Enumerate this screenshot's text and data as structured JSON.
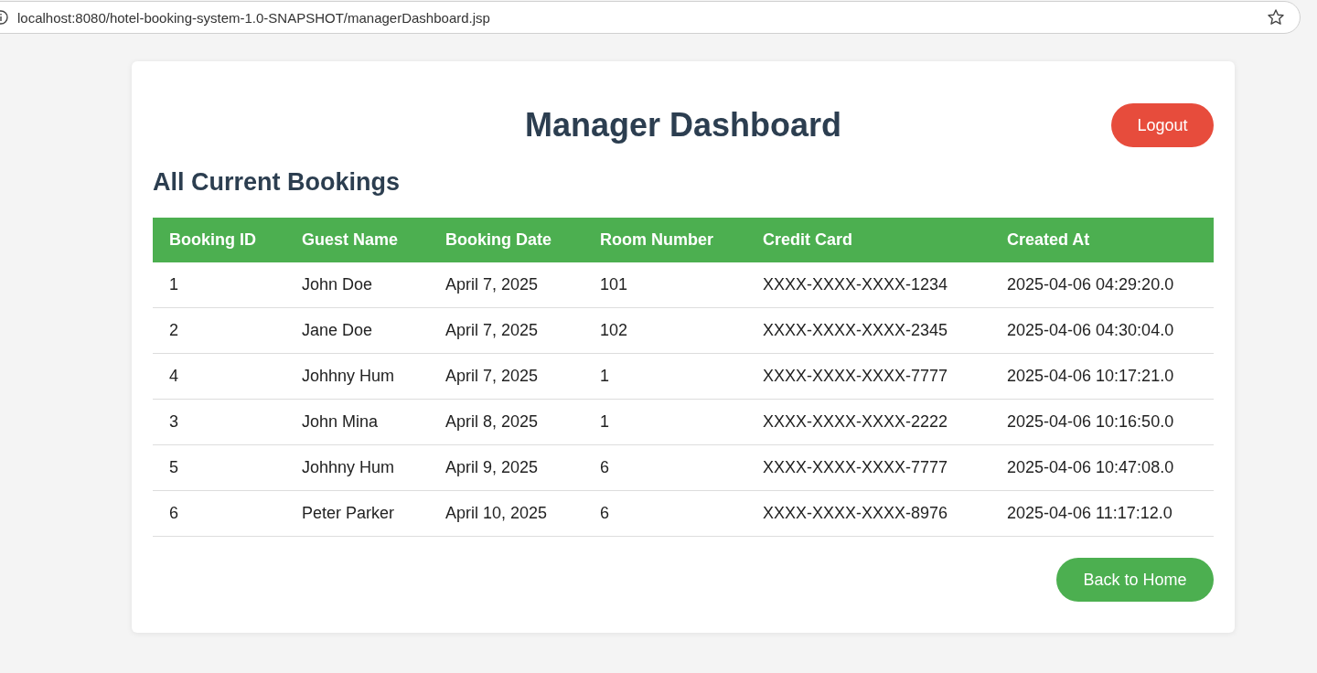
{
  "address_bar": {
    "url": "localhost:8080/hotel-booking-system-1.0-SNAPSHOT/managerDashboard.jsp"
  },
  "header": {
    "title": "Manager Dashboard",
    "logout_button": "Logout"
  },
  "section_title": "All Current Bookings",
  "table": {
    "columns": [
      "Booking ID",
      "Guest Name",
      "Booking Date",
      "Room Number",
      "Credit Card",
      "Created At"
    ],
    "rows": [
      [
        "1",
        "John Doe",
        "April 7, 2025",
        "101",
        "XXXX-XXXX-XXXX-1234",
        "2025-04-06 04:29:20.0"
      ],
      [
        "2",
        "Jane Doe",
        "April 7, 2025",
        "102",
        "XXXX-XXXX-XXXX-2345",
        "2025-04-06 04:30:04.0"
      ],
      [
        "4",
        "Johhny Hum",
        "April 7, 2025",
        "1",
        "XXXX-XXXX-XXXX-7777",
        "2025-04-06 10:17:21.0"
      ],
      [
        "3",
        "John Mina",
        "April 8, 2025",
        "1",
        "XXXX-XXXX-XXXX-2222",
        "2025-04-06 10:16:50.0"
      ],
      [
        "5",
        "Johhny Hum",
        "April 9, 2025",
        "6",
        "XXXX-XXXX-XXXX-7777",
        "2025-04-06 10:47:08.0"
      ],
      [
        "6",
        "Peter Parker",
        "April 10, 2025",
        "6",
        "XXXX-XXXX-XXXX-8976",
        "2025-04-06 11:17:12.0"
      ]
    ]
  },
  "back_button": "Back to Home"
}
